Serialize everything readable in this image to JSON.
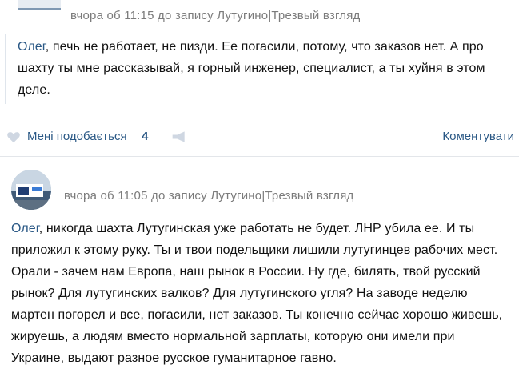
{
  "comment1": {
    "time": "вчора об 11:15",
    "post_prefix": "до запису",
    "post_link": "Лутугино|Трезвый взгляд",
    "reply_to": "Олег",
    "text": ", печь не работает, не пизди. Ее погасили, потому, что заказов нет. А про шахту ты мне рассказывай, я горный инженер, специалист, а ты хуйня в этом деле."
  },
  "actions": {
    "like_label": "Мені подобається",
    "like_count": "4",
    "reply_label": "Коментувати",
    "like_icon": "heart-icon",
    "share_icon": "megaphone-icon"
  },
  "comment2": {
    "time": "вчора об 11:05",
    "post_prefix": "до запису",
    "post_link": "Лутугино|Трезвый взгляд",
    "reply_to": "Олег",
    "text": ", никогда шахта Лутугинская уже работать не будет. ЛНР убила ее. И ты приложил к этому руку. Ты и твои подельщики лишили лутугинцев рабочих мест. Орали - зачем нам Европа, наш рынок в России. Ну где, билять, твой русский рынок? Для лутугинских валков? Для лутугинского угля? На заводе неделю мартен погорел и все, погасили, нет заказов. Ты конечно сейчас хорошо живешь, жируешь, а людям вместо нормальной зарплаты, которую они имели при Украине, выдают разное русское гуманитарное гавно."
  },
  "colors": {
    "link": "#2a5885",
    "meta": "#7b7b7b",
    "divider": "#e3e6ea"
  }
}
